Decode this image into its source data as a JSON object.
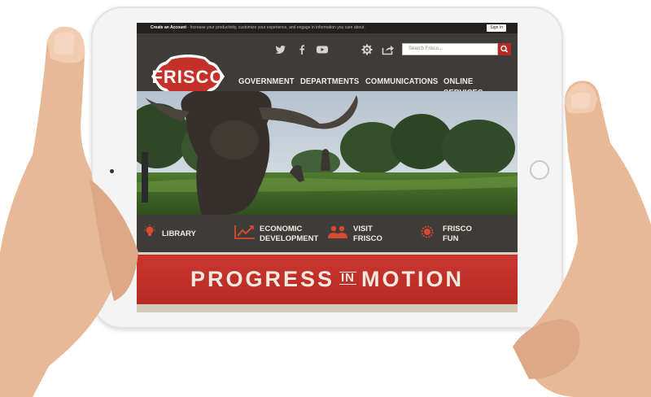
{
  "topbar": {
    "account_link": "Create an Account",
    "message": " - Increase your productivity, customize your experience, and engage in information you care about.",
    "signin_label": "Sign In"
  },
  "header": {
    "logo_text": "FRISCO",
    "search_placeholder": "Search Frisco...",
    "social_icons": [
      "twitter-icon",
      "facebook-icon",
      "youtube-icon"
    ],
    "tool_icons": [
      "gear-icon",
      "share-icon"
    ]
  },
  "nav": {
    "items": [
      {
        "label": "GOVERNMENT"
      },
      {
        "label": "DEPARTMENTS"
      },
      {
        "label": "COMMUNICATIONS"
      },
      {
        "label": "ONLINE SERVICES"
      }
    ]
  },
  "quicklinks": [
    {
      "line1": "LIBRARY",
      "line2": "",
      "icon": "lightbulb-icon"
    },
    {
      "line1": "ECONOMIC",
      "line2": "DEVELOPMENT",
      "icon": "chart-icon"
    },
    {
      "line1": "VISIT",
      "line2": "FRISCO",
      "icon": "people-icon"
    },
    {
      "line1": "FRISCO",
      "line2": "FUN",
      "icon": "sun-icon"
    }
  ],
  "banner": {
    "word1": "PROGRESS",
    "word2": "IN",
    "word3": "MOTION"
  },
  "colors": {
    "brand_red": "#c4312b",
    "header_dark": "#3e3c39",
    "topbar_dark": "#23211f",
    "tan": "#c9bfa9"
  }
}
